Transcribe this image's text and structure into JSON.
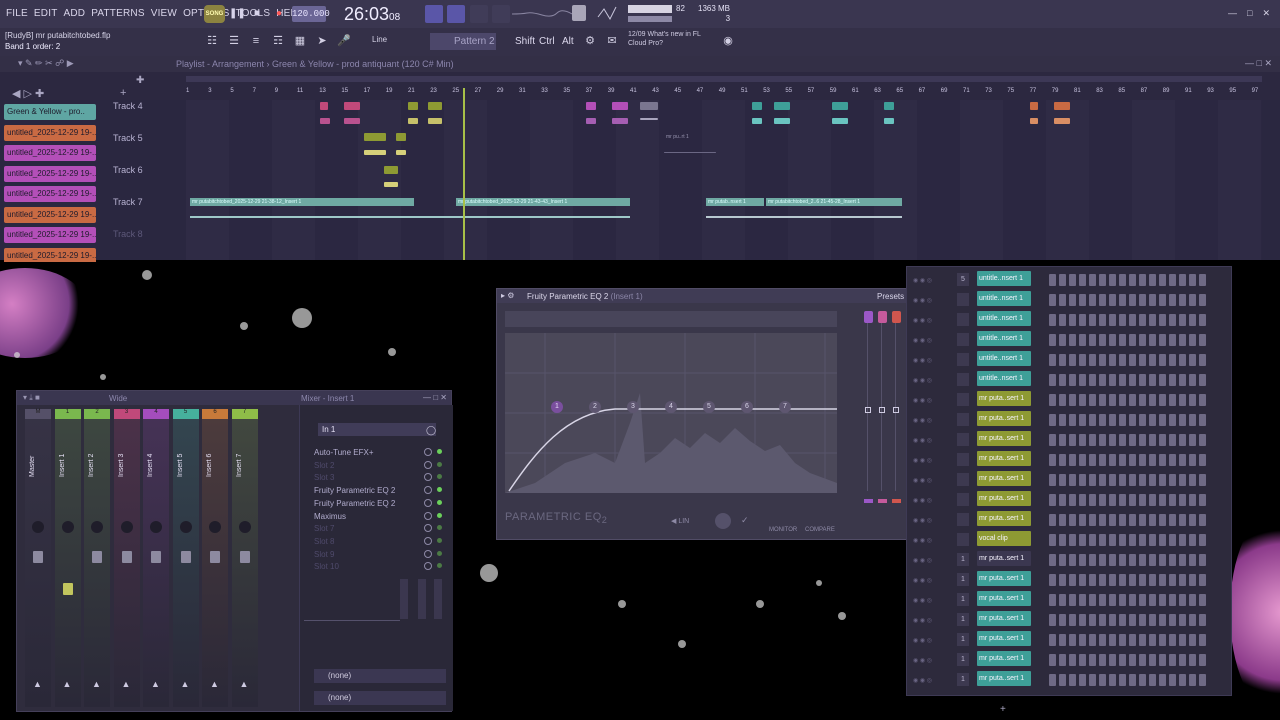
{
  "menu": [
    "FILE",
    "EDIT",
    "ADD",
    "PATTERNS",
    "VIEW",
    "OPTIONS",
    "TOOLS",
    "HELP"
  ],
  "transport": {
    "song_badge": "SONG",
    "tempo": "120.000",
    "time_main": "26:03",
    "time_sub": "08"
  },
  "status": {
    "cpu": "82",
    "mem_top": "1363 MB",
    "mem_bottom": "3"
  },
  "file": {
    "title": "[RudyB] mr putabitchtobed.flp",
    "hint": "Band 1 order: 2"
  },
  "toolbar": {
    "snap": "Line",
    "pattern": "Pattern 2",
    "shift": "Shift",
    "ctrl": "Ctrl",
    "alt": "Alt"
  },
  "news": {
    "date": "12/09",
    "line1": "What's new in FL",
    "line2": "Cloud Pro?"
  },
  "playlist": {
    "title": "Playlist - Arrangement",
    "breadcrumb": "Green & Yellow - prod antiquant (120 C# Min)",
    "ruler": [
      "1",
      "3",
      "5",
      "7",
      "9",
      "11",
      "13",
      "15",
      "17",
      "19",
      "21",
      "23",
      "25",
      "27",
      "29",
      "31",
      "33",
      "35",
      "37",
      "39",
      "41",
      "43",
      "45",
      "47",
      "49",
      "51",
      "53",
      "55",
      "57",
      "59",
      "61",
      "63",
      "65",
      "67",
      "69",
      "71",
      "73",
      "75",
      "77",
      "79",
      "81",
      "83",
      "85",
      "87",
      "89",
      "91",
      "93",
      "95",
      "97"
    ],
    "patterns": [
      {
        "label": "Green & Yellow - pro..",
        "color": "#5fa6a3"
      },
      {
        "label": "untitled_2025-12-29 19-..",
        "color": "#c96a43"
      },
      {
        "label": "untitled_2025-12-29 19-..",
        "color": "#b34fb8"
      },
      {
        "label": "untitled_2025-12-29 19-..",
        "color": "#b34fb8"
      },
      {
        "label": "untitled_2025-12-29 19-..",
        "color": "#b34fb8"
      },
      {
        "label": "untitled_2025-12-29 19-..",
        "color": "#c96a43"
      },
      {
        "label": "untitled_2025-12-29 19-..",
        "color": "#b34fb8"
      },
      {
        "label": "untitled_2025-12-29 19-..",
        "color": "#c96a43"
      }
    ],
    "tracks": [
      "Track 4",
      "Track 5",
      "Track 6",
      "Track 7",
      "Track 8"
    ],
    "clip_labels": {
      "c1": "mr putabitchtobed_2025-12-29 21-38-12_Insert 1",
      "c2": "mr putabitchtobed_2025-12-29 21-43-43_Insert 1",
      "c3": "mr putab..nsert 1",
      "c4": "mr putabitchtobed_2..6 21-45-28_Insert 1",
      "c5": "mr pu..rt 1"
    }
  },
  "mixer": {
    "title": "Mixer - Insert 1",
    "preset": "Wide",
    "strips": [
      {
        "label": "Master",
        "color": "#555068",
        "num": "M"
      },
      {
        "label": "Insert 1",
        "color": "#7ab84e",
        "num": "1"
      },
      {
        "label": "Insert 2",
        "color": "#7ab84e",
        "num": "2"
      },
      {
        "label": "Insert 3",
        "color": "#c0497a",
        "num": "3"
      },
      {
        "label": "Insert 4",
        "color": "#a44dbd",
        "num": "4"
      },
      {
        "label": "Insert 5",
        "color": "#46b09c",
        "num": "5"
      },
      {
        "label": "Insert 6",
        "color": "#c77a3a",
        "num": "6"
      },
      {
        "label": "Insert 7",
        "color": "#8fbd48",
        "num": "7"
      }
    ],
    "input": "In 1",
    "slots": [
      {
        "label": "Auto-Tune EFX+",
        "empty": false
      },
      {
        "label": "Slot 2",
        "empty": true
      },
      {
        "label": "Slot 3",
        "empty": true
      },
      {
        "label": "Fruity Parametric EQ 2",
        "empty": false
      },
      {
        "label": "Fruity Parametric EQ 2",
        "empty": false
      },
      {
        "label": "Maximus",
        "empty": false
      },
      {
        "label": "Slot 7",
        "empty": true
      },
      {
        "label": "Slot 8",
        "empty": true
      },
      {
        "label": "Slot 9",
        "empty": true
      },
      {
        "label": "Slot 10",
        "empty": true
      }
    ],
    "send_a": "(none)",
    "send_b": "(none)"
  },
  "eq": {
    "title": "Fruity Parametric EQ 2",
    "insert": "(Insert 1)",
    "presets": "Presets",
    "logo": "PARAMETRIC EQ",
    "logo_sub": "2",
    "monitor": "MONITOR",
    "compare": "COMPARE",
    "bands": [
      "1",
      "2",
      "3",
      "4",
      "5",
      "6",
      "7"
    ],
    "band_colors": [
      "#9b58c7",
      "#c55a9c",
      "#d0564e",
      "#a7a84d",
      "#52b35a",
      "#40a6a3",
      "#4f7ec3"
    ]
  },
  "rack": {
    "channels": [
      {
        "label": "untitle..nsert 1",
        "color": "#3e9f98",
        "num": "5"
      },
      {
        "label": "untitle..nsert 1",
        "color": "#3e9f98",
        "num": ""
      },
      {
        "label": "untitle..nsert 1",
        "color": "#3e9f98",
        "num": ""
      },
      {
        "label": "untitle..nsert 1",
        "color": "#3e9f98",
        "num": ""
      },
      {
        "label": "untitle..nsert 1",
        "color": "#3e9f98",
        "num": ""
      },
      {
        "label": "untitle..nsert 1",
        "color": "#3e9f98",
        "num": ""
      },
      {
        "label": "mr puta..sert 1",
        "color": "#8e9a33",
        "num": ""
      },
      {
        "label": "mr puta..sert 1",
        "color": "#8e9a33",
        "num": ""
      },
      {
        "label": "mr puta..sert 1",
        "color": "#8e9a33",
        "num": ""
      },
      {
        "label": "mr puta..sert 1",
        "color": "#8e9a33",
        "num": ""
      },
      {
        "label": "mr puta..sert 1",
        "color": "#8e9a33",
        "num": ""
      },
      {
        "label": "mr puta..sert 1",
        "color": "#8e9a33",
        "num": ""
      },
      {
        "label": "mr puta..sert 1",
        "color": "#8e9a33",
        "num": ""
      },
      {
        "label": "vocal clip",
        "color": "#8e9a33",
        "num": ""
      },
      {
        "label": "mr puta..sert 1",
        "color": "#3b3750",
        "num": "1"
      },
      {
        "label": "mr puta..sert 1",
        "color": "#3e9f98",
        "num": "1"
      },
      {
        "label": "mr puta..sert 1",
        "color": "#3e9f98",
        "num": "1"
      },
      {
        "label": "mr puta..sert 1",
        "color": "#3e9f98",
        "num": "1"
      },
      {
        "label": "mr puta..sert 1",
        "color": "#3e9f98",
        "num": "1"
      },
      {
        "label": "mr puta..sert 1",
        "color": "#3e9f98",
        "num": "1"
      },
      {
        "label": "mr puta..sert 1",
        "color": "#3e9f98",
        "num": "1"
      }
    ]
  }
}
